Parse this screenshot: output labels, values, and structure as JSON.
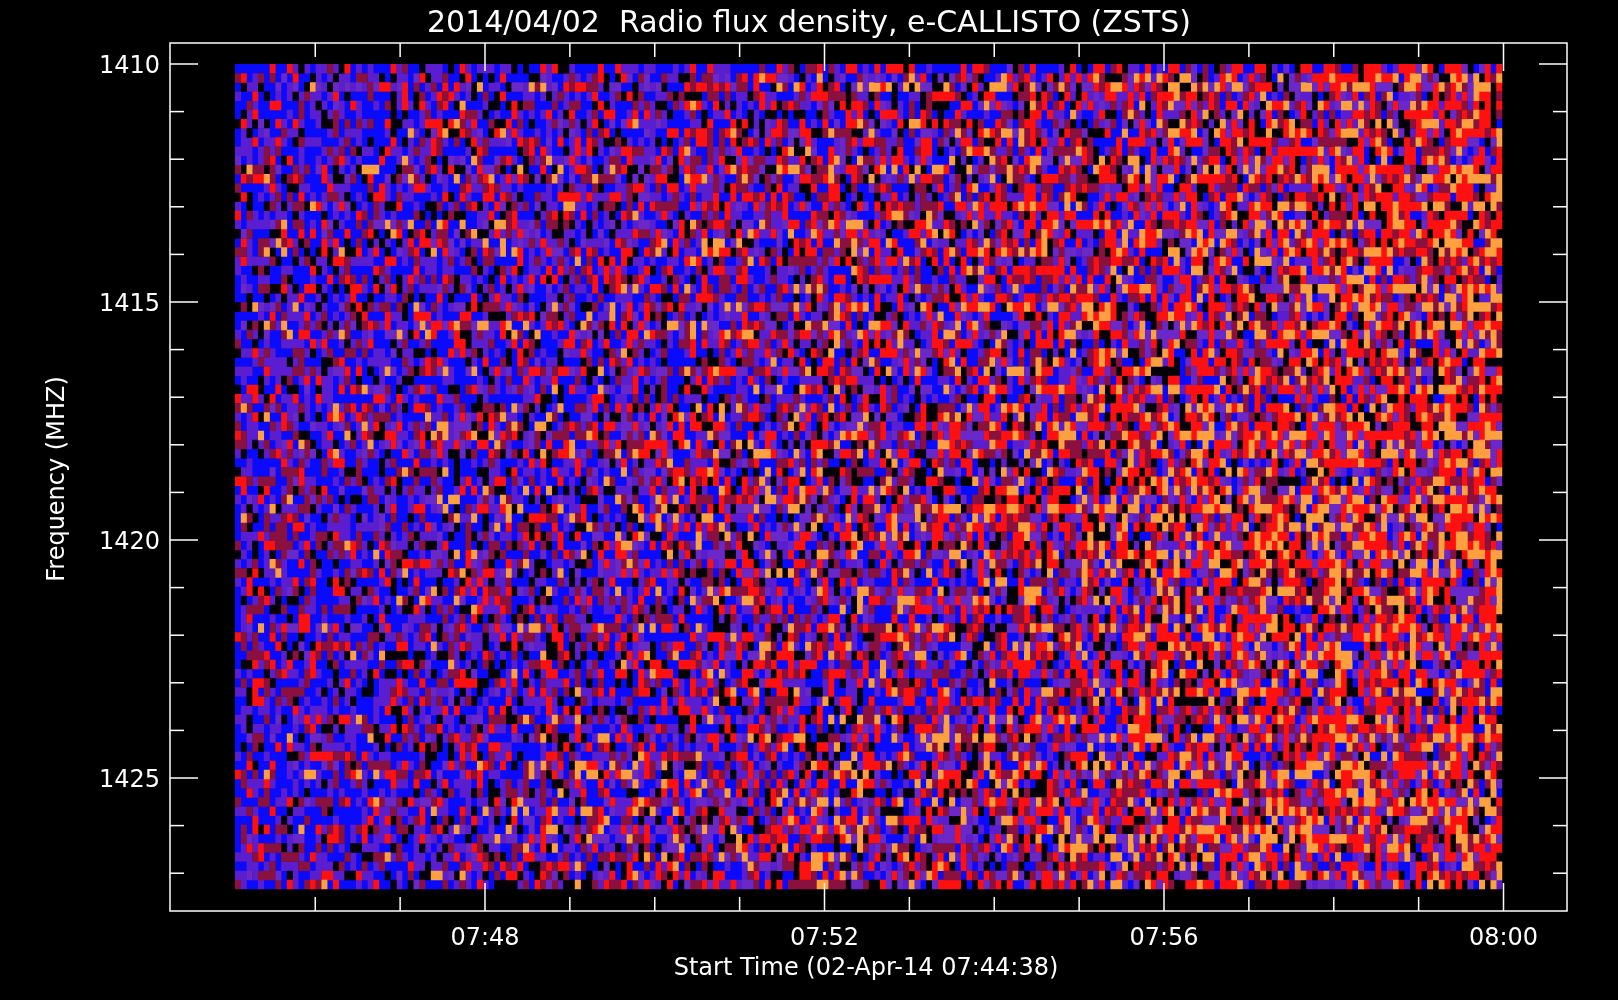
{
  "chart": {
    "title": "2014/04/02  Radio flux density, e-CALLISTO (ZSTS)",
    "ylabel": "Frequency (MHZ)",
    "xlabel": "Start Time (02-Apr-14 07:44:38)",
    "yticks": [
      "1410",
      "1415",
      "1420",
      "1425"
    ],
    "xticks": [
      "07:48",
      "07:52",
      "07:56",
      "08:00"
    ]
  }
}
